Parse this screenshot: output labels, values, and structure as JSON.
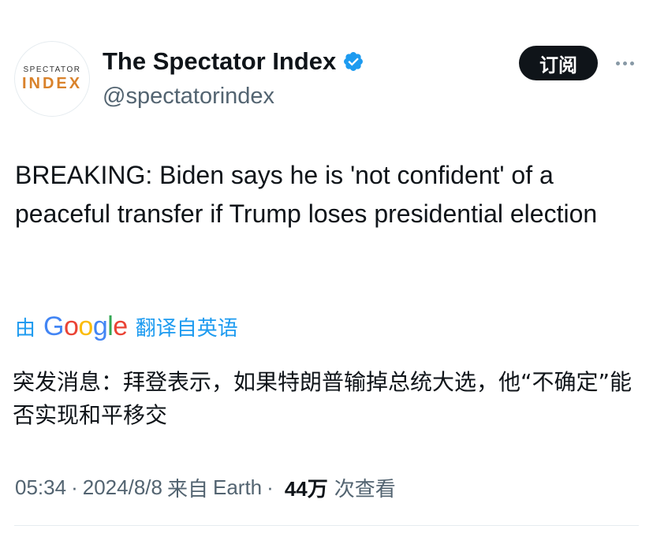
{
  "account": {
    "avatar_line1": "SPECTATOR",
    "avatar_line2": "INDEX",
    "display_name": "The Spectator Index",
    "handle": "@spectatorindex",
    "verified_icon": "verified-badge-icon",
    "verified_color": "#1d9bf0"
  },
  "actions": {
    "follow_label": "订阅",
    "more_icon": "more-horizontal-icon"
  },
  "tweet": {
    "text": "BREAKING: Biden says he is 'not confident' of a peaceful transfer if Trump loses presidential election"
  },
  "translation": {
    "prefix": "由",
    "provider": "Google",
    "suffix": "翻译自英语",
    "text": "突发消息：拜登表示，如果特朗普输掉总统大选，他“不确定”能否实现和平移交"
  },
  "meta": {
    "time": "05:34",
    "date": "2024/8/8",
    "source_prefix": "来自",
    "source": "Earth",
    "separator": "·",
    "views_count": "44万",
    "views_label": "次查看"
  },
  "colors": {
    "accent": "#1d9bf0",
    "text_primary": "#0f1419",
    "text_secondary": "#536471",
    "button_bg": "#0f1419"
  }
}
